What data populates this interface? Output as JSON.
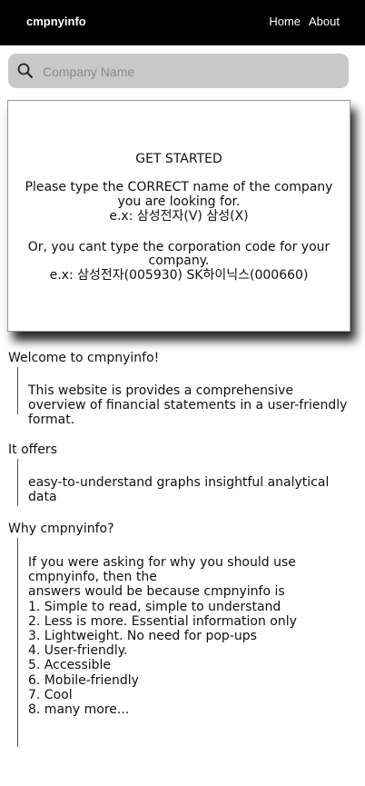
{
  "nav": {
    "brand": "cmpnyinfo",
    "links": [
      "Home",
      "About"
    ]
  },
  "search": {
    "placeholder": "Company Name",
    "value": "",
    "icon": "search-icon"
  },
  "get_started": {
    "title": "GET STARTED",
    "lines": [
      "Please type the CORRECT name of the company",
      "you are looking for.",
      "e.x: 삼성전자(V) 삼성(X)",
      "Or, you cant type the corporation code for your",
      "company.",
      "e.x: 삼성전자(005930) SK하이닉스(000660)"
    ]
  },
  "sections": [
    {
      "heading": "Welcome to cmpnyinfo!",
      "lines": [
        "This website is provides a comprehensive",
        "overview of financial statements in a user-friendly",
        "format."
      ]
    },
    {
      "heading": "It offers",
      "lines": [
        "easy-to-understand graphs insightful analytical",
        "data"
      ]
    },
    {
      "heading": "Why cmpnyinfo?",
      "lines": [
        "If you were asking for why you should use",
        "cmpnyinfo, then the",
        "answers would be because cmpnyinfo is",
        "1. Simple to read, simple to understand",
        "2. Less is more. Essential information only",
        "3. Lightweight. No need for pop-ups",
        "4. User-friendly.",
        "5. Accessible",
        "6. Mobile-friendly",
        "7. Cool",
        "8. many more..."
      ]
    }
  ],
  "colors": {
    "navbar": "#000000",
    "search_background": "#c8c8c8"
  }
}
